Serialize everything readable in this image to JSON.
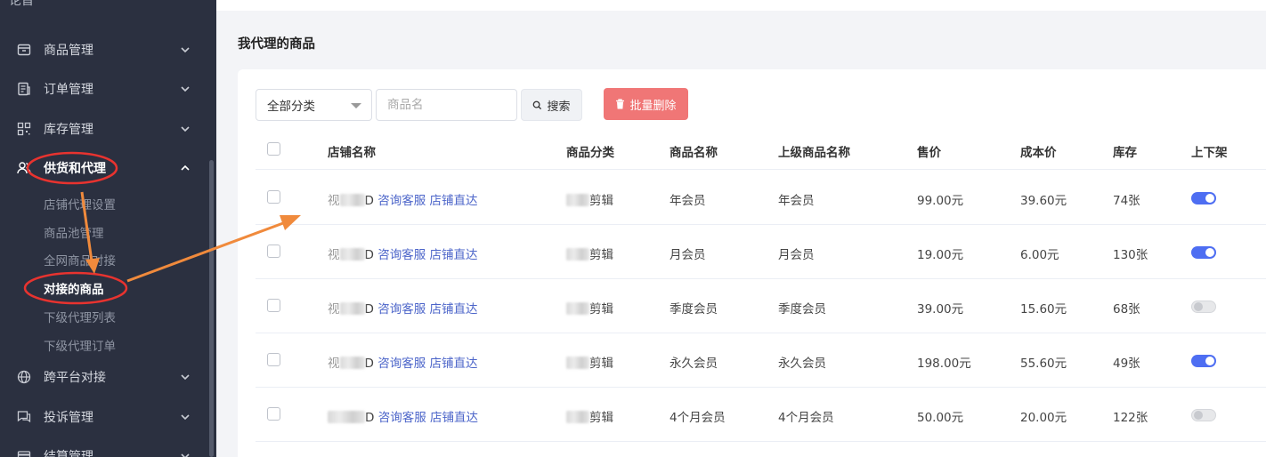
{
  "sidebar": {
    "cut_top_label": "论首",
    "menu": [
      {
        "label": "商品管理",
        "icon": "box-icon"
      },
      {
        "label": "订单管理",
        "icon": "order-icon"
      },
      {
        "label": "库存管理",
        "icon": "grid-icon"
      },
      {
        "label": "供货和代理",
        "icon": "users-icon",
        "open": true
      },
      {
        "label": "跨平台对接",
        "icon": "globe-icon"
      },
      {
        "label": "投诉管理",
        "icon": "chat-icon"
      },
      {
        "label": "结算管理",
        "icon": "card-icon"
      }
    ],
    "submenu": [
      {
        "label": "店铺代理设置"
      },
      {
        "label": "商品池管理"
      },
      {
        "label": "全网商品对接"
      },
      {
        "label": "对接的商品",
        "active": true
      },
      {
        "label": "下级代理列表"
      },
      {
        "label": "下级代理订单"
      }
    ]
  },
  "page": {
    "title": "我代理的商品"
  },
  "toolbar": {
    "category_select": "全部分类",
    "search_placeholder": "商品名",
    "search_label": "搜索",
    "bulk_delete_label": "批量删除"
  },
  "table": {
    "headers": {
      "shop": "店铺名称",
      "category": "商品分类",
      "name": "商品名称",
      "parent_name": "上级商品名称",
      "price": "售价",
      "cost": "成本价",
      "stock": "库存",
      "status": "上下架"
    },
    "rows": [
      {
        "shop_prefix": "视",
        "shop_suffix": "D",
        "consult": "咨询客服",
        "shop_link": "店铺直达",
        "category": "剪辑",
        "name": "年会员",
        "parent_name": "年会员",
        "price": "99.00元",
        "cost": "39.60元",
        "stock": "74张",
        "on": true
      },
      {
        "shop_prefix": "视",
        "shop_suffix": "D",
        "consult": "咨询客服",
        "shop_link": "店铺直达",
        "category": "剪辑",
        "name": "月会员",
        "parent_name": "月会员",
        "price": "19.00元",
        "cost": "6.00元",
        "stock": "130张",
        "on": true
      },
      {
        "shop_prefix": "视",
        "shop_suffix": "D",
        "consult": "咨询客服",
        "shop_link": "店铺直达",
        "category": "剪辑",
        "name": "季度会员",
        "parent_name": "季度会员",
        "price": "39.00元",
        "cost": "15.60元",
        "stock": "68张",
        "on": false
      },
      {
        "shop_prefix": "视",
        "shop_suffix": "D",
        "consult": "咨询客服",
        "shop_link": "店铺直达",
        "category": "剪辑",
        "name": "永久会员",
        "parent_name": "永久会员",
        "price": "198.00元",
        "cost": "55.60元",
        "stock": "49张",
        "on": true
      },
      {
        "shop_prefix": "",
        "shop_suffix": "D",
        "consult": "咨询客服",
        "shop_link": "店铺直达",
        "category": "剪辑",
        "name": "4个月会员",
        "parent_name": "4个月会员",
        "price": "50.00元",
        "cost": "20.00元",
        "stock": "122张",
        "on": false
      }
    ]
  },
  "colors": {
    "sidebar_bg": "#2b3040",
    "accent": "#4e6ef2",
    "link": "#4b64c9",
    "danger": "#f07676",
    "annotation": "#e8332f",
    "arrow": "#f08a3c"
  }
}
